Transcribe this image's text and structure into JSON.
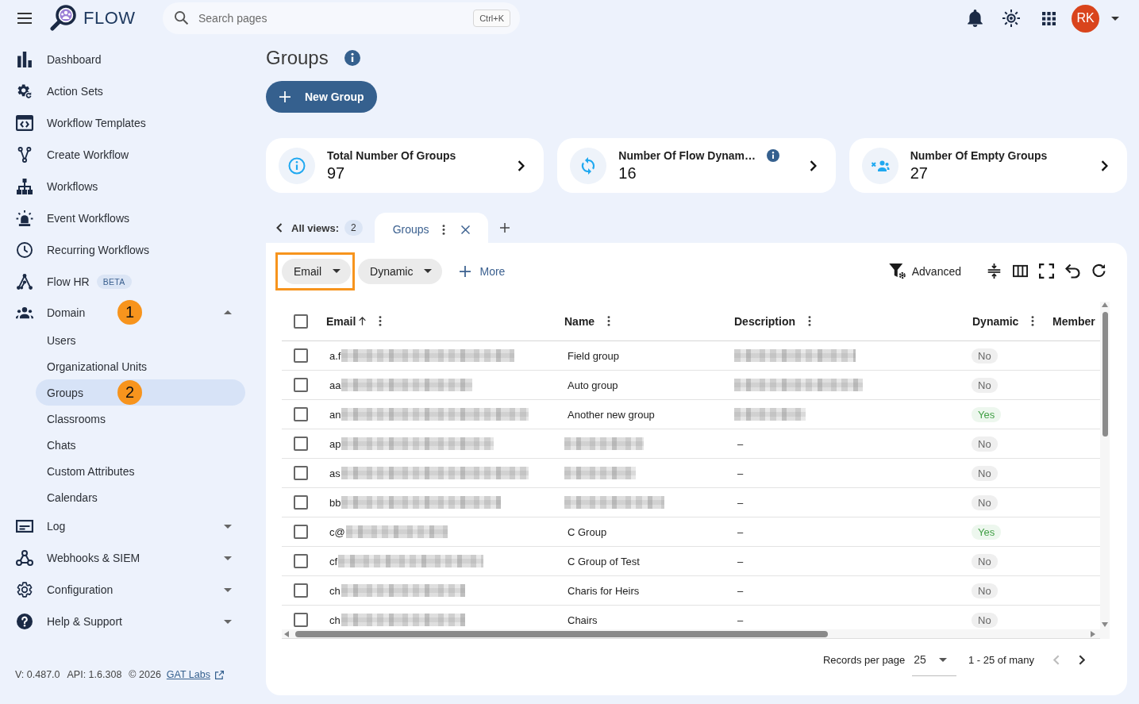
{
  "topbar": {
    "app_name": "FLOW",
    "search": {
      "placeholder": "Search pages",
      "shortcut": "Ctrl+K"
    },
    "avatar": {
      "initials": "RK"
    }
  },
  "sidebar": {
    "items": [
      {
        "label": "Dashboard",
        "selected": false
      },
      {
        "label": "Action Sets",
        "selected": false
      },
      {
        "label": "Workflow Templates",
        "selected": false
      },
      {
        "label": "Create Workflow",
        "selected": false
      },
      {
        "label": "Workflows",
        "selected": false
      },
      {
        "label": "Event Workflows",
        "selected": false
      },
      {
        "label": "Recurring Workflows",
        "selected": false
      },
      {
        "label": "Flow HR",
        "selected": false,
        "badge": "BETA"
      },
      {
        "label": "Domain",
        "selected": false,
        "expanded": true,
        "marker": "1",
        "children": [
          {
            "label": "Users",
            "selected": false
          },
          {
            "label": "Organizational Units",
            "selected": false
          },
          {
            "label": "Groups",
            "selected": true,
            "marker": "2"
          },
          {
            "label": "Classrooms",
            "selected": false
          },
          {
            "label": "Chats",
            "selected": false
          },
          {
            "label": "Custom Attributes",
            "selected": false
          },
          {
            "label": "Calendars",
            "selected": false
          }
        ]
      },
      {
        "label": "Log",
        "selected": false,
        "expanded": false
      },
      {
        "label": "Webhooks & SIEM",
        "selected": false,
        "expanded": false
      },
      {
        "label": "Configuration",
        "selected": false,
        "expanded": false
      },
      {
        "label": "Help & Support",
        "selected": false,
        "expanded": false
      }
    ],
    "footer": {
      "version": "V: 0.487.0",
      "api": "API: 1.6.308",
      "copyright": "© 2026",
      "link": "GAT Labs"
    }
  },
  "page": {
    "title": "Groups",
    "new_button": "New Group"
  },
  "stats": [
    {
      "title": "Total Number Of Groups",
      "value": "97",
      "info": false
    },
    {
      "title": "Number Of Flow Dynam…",
      "value": "16",
      "info": true
    },
    {
      "title": "Number Of Empty Groups",
      "value": "27",
      "info": false
    }
  ],
  "views": {
    "label": "All views:",
    "count": "2",
    "tabs": [
      {
        "label": "Groups",
        "selected": true
      }
    ]
  },
  "toolbar": {
    "filters": [
      {
        "label": "Email",
        "highlighted": true
      },
      {
        "label": "Dynamic",
        "highlighted": false
      }
    ],
    "more": "More",
    "advanced": "Advanced"
  },
  "table": {
    "all_selected": false,
    "columns": [
      {
        "label": "Email",
        "sort_ascending": true
      },
      {
        "label": "Name"
      },
      {
        "label": "Description"
      },
      {
        "label": "Dynamic"
      },
      {
        "label": "Member"
      }
    ],
    "rows": [
      {
        "selected": false,
        "email": "a.f",
        "name": {
          "kind": "text",
          "text": "Field group"
        },
        "description": {
          "kind": "redacted"
        },
        "dynamic": {
          "text": "No",
          "on": false
        }
      },
      {
        "selected": false,
        "email": "aa",
        "name": {
          "kind": "text",
          "text": "Auto group"
        },
        "description": {
          "kind": "redacted"
        },
        "dynamic": {
          "text": "No",
          "on": false
        }
      },
      {
        "selected": false,
        "email": "an",
        "name": {
          "kind": "text",
          "text": "Another new group"
        },
        "description": {
          "kind": "redacted"
        },
        "dynamic": {
          "text": "Yes",
          "on": true
        }
      },
      {
        "selected": false,
        "email": "ap",
        "name": {
          "kind": "redacted"
        },
        "description": {
          "kind": "text",
          "text": "–"
        },
        "dynamic": {
          "text": "No",
          "on": false
        }
      },
      {
        "selected": false,
        "email": "as",
        "name": {
          "kind": "redacted"
        },
        "description": {
          "kind": "text",
          "text": "–"
        },
        "dynamic": {
          "text": "No",
          "on": false
        }
      },
      {
        "selected": false,
        "email": "bb",
        "name": {
          "kind": "redacted"
        },
        "description": {
          "kind": "text",
          "text": "–"
        },
        "dynamic": {
          "text": "No",
          "on": false
        }
      },
      {
        "selected": false,
        "email": "c@",
        "name": {
          "kind": "text",
          "text": "C Group"
        },
        "description": {
          "kind": "text",
          "text": "–"
        },
        "dynamic": {
          "text": "Yes",
          "on": true
        }
      },
      {
        "selected": false,
        "email": "cf",
        "name": {
          "kind": "text",
          "text": "C Group of Test"
        },
        "description": {
          "kind": "text",
          "text": "–"
        },
        "dynamic": {
          "text": "No",
          "on": false
        }
      },
      {
        "selected": false,
        "email": "ch",
        "name": {
          "kind": "text",
          "text": "Charis for Heirs"
        },
        "description": {
          "kind": "text",
          "text": "–"
        },
        "dynamic": {
          "text": "No",
          "on": false
        }
      },
      {
        "selected": false,
        "email": "ch",
        "name": {
          "kind": "text",
          "text": "Chairs"
        },
        "description": {
          "kind": "text",
          "text": "–"
        },
        "dynamic": {
          "text": "No",
          "on": false
        }
      }
    ]
  },
  "pagination": {
    "label": "Records per page",
    "page_size": "25",
    "range": "1 - 25 of many",
    "prev_disabled": true,
    "next_disabled": false
  }
}
